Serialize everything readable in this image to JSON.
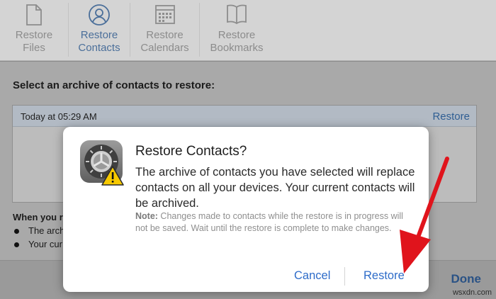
{
  "toolbar": {
    "tabs": [
      {
        "line1": "Restore",
        "line2": "Files",
        "icon": "document-icon",
        "active": false
      },
      {
        "line1": "Restore",
        "line2": "Contacts",
        "icon": "contact-icon",
        "active": true
      },
      {
        "line1": "Restore",
        "line2": "Calendars",
        "icon": "calendar-icon",
        "active": false
      },
      {
        "line1": "Restore",
        "line2": "Bookmarks",
        "icon": "book-icon",
        "active": false
      }
    ]
  },
  "main": {
    "title": "Select an archive of contacts to restore:",
    "archives": [
      {
        "date": "Today at 05:29 AM",
        "action": "Restore"
      }
    ],
    "note_head": "When you re",
    "bullets": [
      "The arch",
      "Your cur"
    ]
  },
  "footer": {
    "done_label": "Done"
  },
  "dialog": {
    "title": "Restore Contacts?",
    "message": "The archive of contacts you have selected will replace contacts on all your devices. Your current contacts will be archived.",
    "note_label": "Note:",
    "note_text": " Changes made to contacts while the restore is in progress will not be saved. Wait until the restore is complete to make changes.",
    "cancel_label": "Cancel",
    "confirm_label": "Restore"
  },
  "watermark": "wsxdn.com",
  "colors": {
    "accent": "#2e6cc9",
    "active_tab": "#4b6f9a",
    "arrow": "#e0141c"
  }
}
